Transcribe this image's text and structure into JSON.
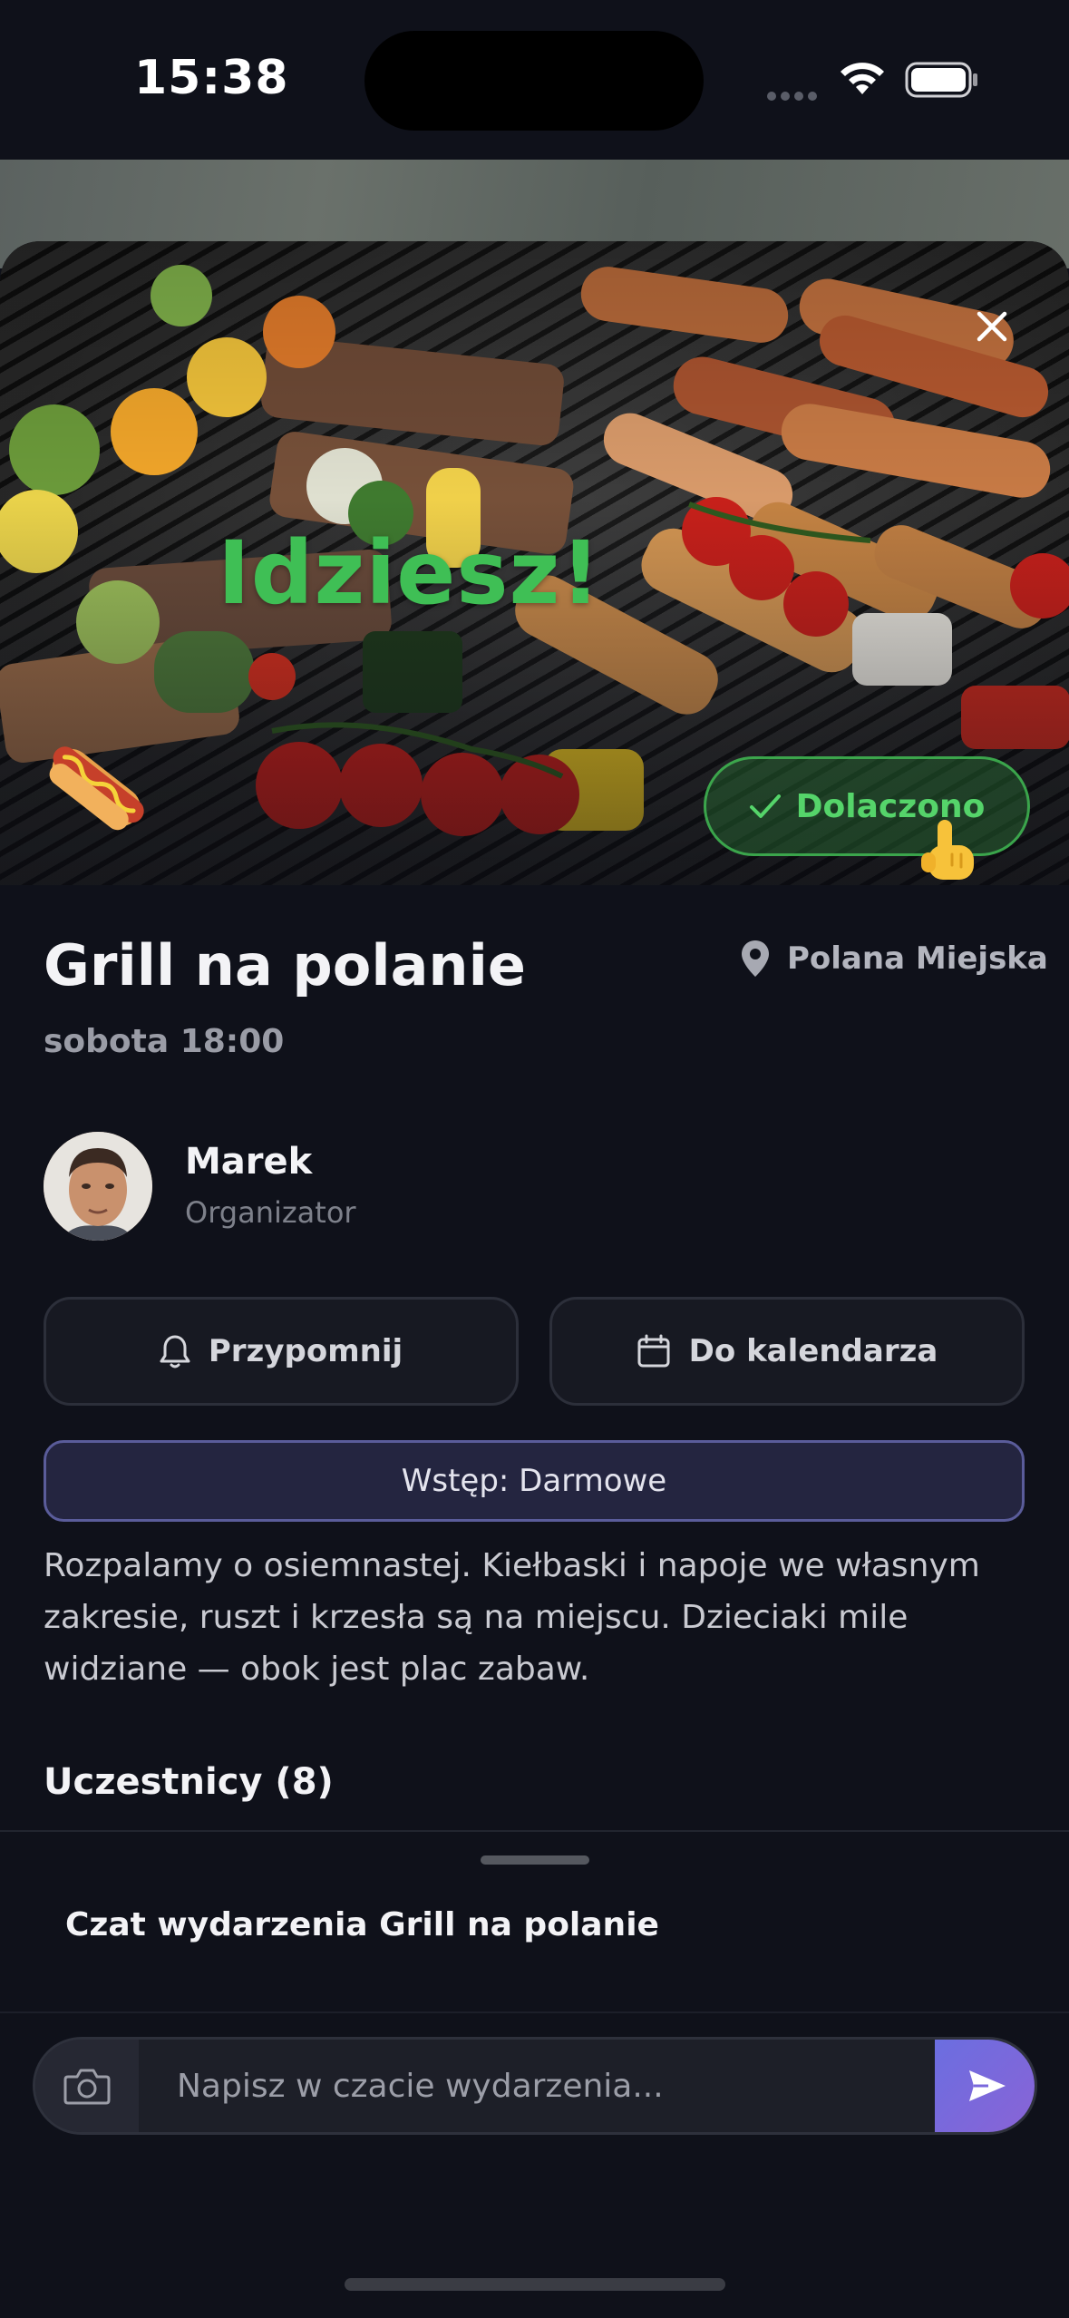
{
  "status_bar": {
    "time": "15:38"
  },
  "hero": {
    "status_text": "Idziesz!",
    "joined_label": "Dolaczono",
    "emoji_hotdog": "🌭",
    "emoji_hand": "👆"
  },
  "event": {
    "title": "Grill na polanie",
    "time": "sobota 18:00",
    "location": "Polana Miejska",
    "organizer": {
      "name": "Marek",
      "role": "Organizator"
    },
    "actions": {
      "remind_label": "Przypomnij",
      "calendar_label": "Do kalendarza"
    },
    "entry": "Wstęp: Darmowe",
    "description": "Rozpalamy o osiemnastej. Kiełbaski i napoje we własnym zakresie, ruszt i krzesła są na miejscu. Dzieciaki mile widziane — obok jest plac zabaw.",
    "participants_heading": "Uczestnicy (8)"
  },
  "chat": {
    "title": "Czat wydarzenia Grill na polanie",
    "input_placeholder": "Napisz w czacie wydarzenia..."
  },
  "icons": {
    "close": "close-icon",
    "check": "check-icon",
    "location": "map-pin-icon",
    "bell": "bell-icon",
    "calendar": "calendar-icon",
    "camera": "camera-icon",
    "send": "send-icon"
  },
  "colors": {
    "background": "#0f111a",
    "accent_green": "#3fbf55",
    "accent_purple": "#6b6ee0",
    "badge_border": "#5a5c9a"
  }
}
